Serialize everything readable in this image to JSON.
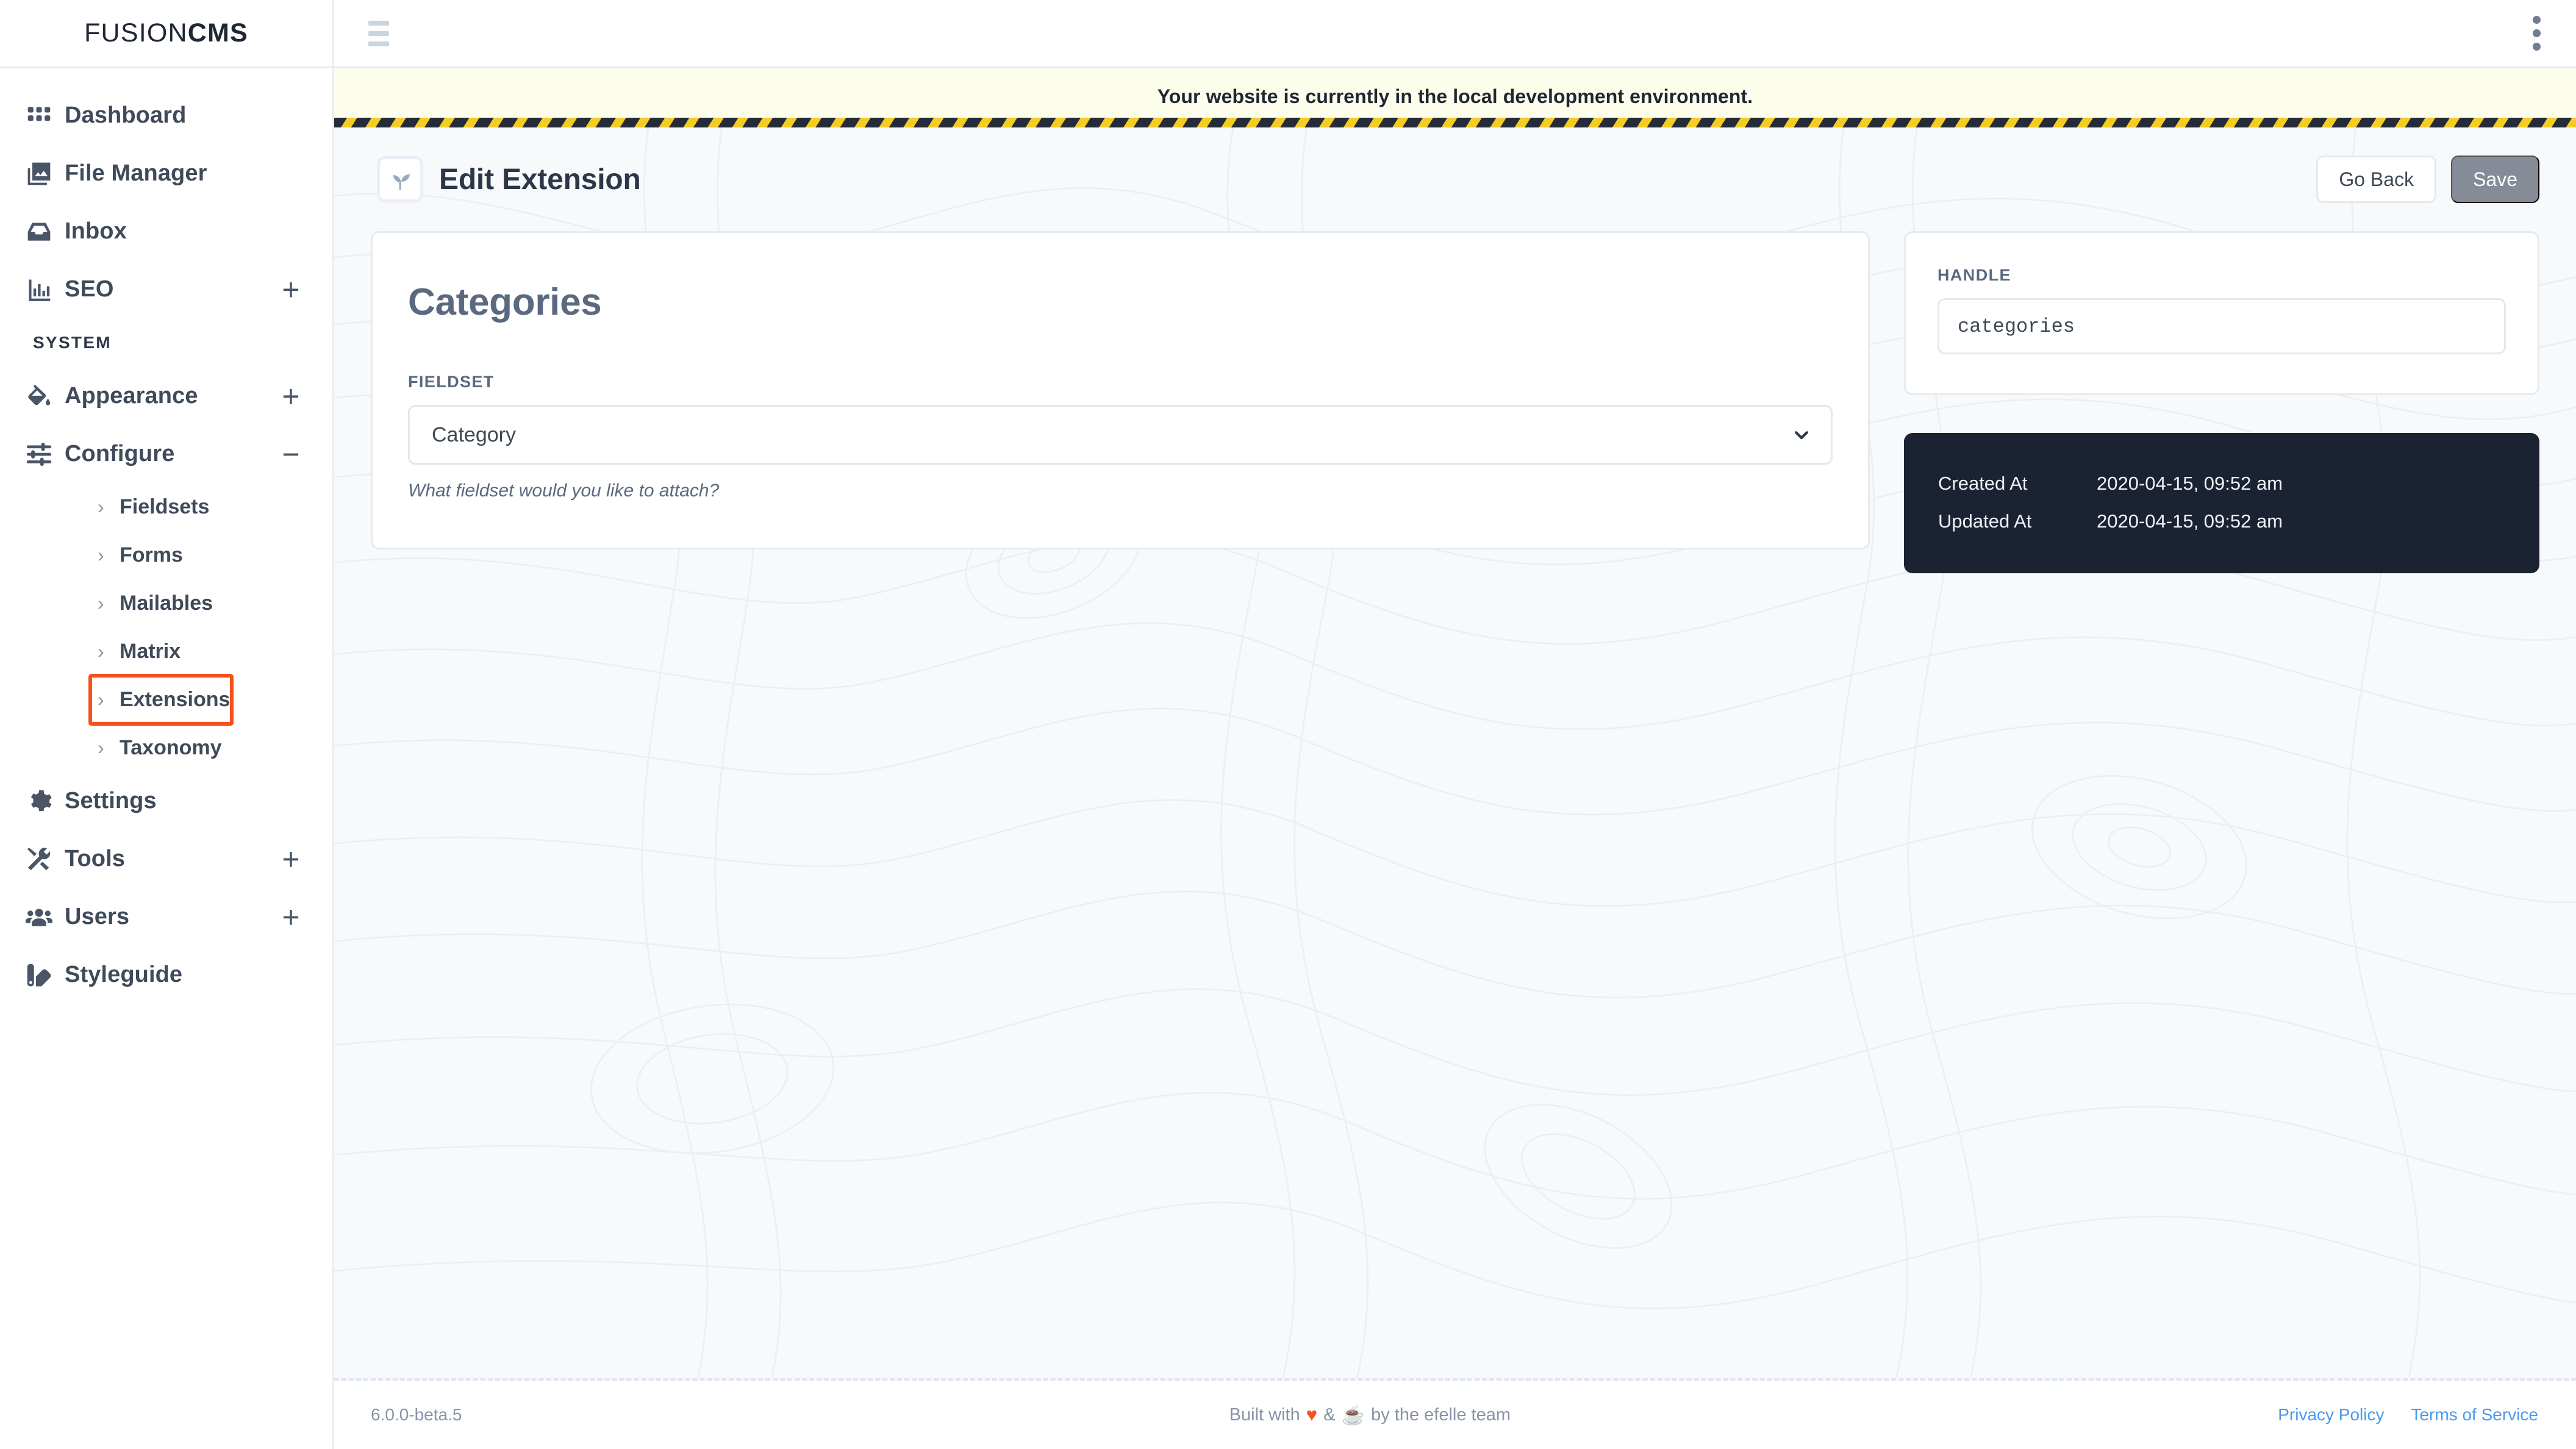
{
  "brand": {
    "light": "FUSION",
    "bold": "CMS"
  },
  "sidebar": {
    "primary_items": [
      {
        "label": "Dashboard",
        "icon": "grid-icon",
        "has_plus": false
      },
      {
        "label": "File Manager",
        "icon": "images-icon",
        "has_plus": false
      },
      {
        "label": "Inbox",
        "icon": "inbox-icon",
        "has_plus": false
      },
      {
        "label": "SEO",
        "icon": "bar-chart-icon",
        "has_plus": true,
        "plus": "+"
      }
    ],
    "section_label": "SYSTEM",
    "system_items": [
      {
        "label": "Appearance",
        "icon": "paint-bucket-icon",
        "has_toggle": true,
        "toggle": "+"
      },
      {
        "label": "Configure",
        "icon": "sliders-icon",
        "has_toggle": true,
        "toggle": "−"
      }
    ],
    "configure_children": [
      {
        "label": "Fieldsets",
        "chevron": "›",
        "highlighted": false
      },
      {
        "label": "Forms",
        "chevron": "›",
        "highlighted": false
      },
      {
        "label": "Mailables",
        "chevron": "›",
        "highlighted": false
      },
      {
        "label": "Matrix",
        "chevron": "›",
        "highlighted": false
      },
      {
        "label": "Extensions",
        "chevron": "›",
        "highlighted": true
      },
      {
        "label": "Taxonomy",
        "chevron": "›",
        "highlighted": false
      }
    ],
    "tail_items": [
      {
        "label": "Settings",
        "icon": "gear-icon",
        "has_plus": false
      },
      {
        "label": "Tools",
        "icon": "tools-icon",
        "has_plus": true,
        "plus": "+"
      },
      {
        "label": "Users",
        "icon": "users-icon",
        "has_plus": true,
        "plus": "+"
      },
      {
        "label": "Styleguide",
        "icon": "swatch-icon",
        "has_plus": false
      }
    ],
    "highlight_color": "#f4511e"
  },
  "topbar": {
    "menu_icon": "hamburger-icon",
    "options_icon": "kebab-menu-icon"
  },
  "env_banner": {
    "text": "Your website is currently in the local development environment."
  },
  "page": {
    "icon": "seedling-icon",
    "title": "Edit Extension",
    "go_back_label": "Go Back",
    "save_label": "Save"
  },
  "main_card": {
    "title": "Categories",
    "fieldset": {
      "label": "FIELDSET",
      "value": "Category",
      "help": "What fieldset would you like to attach?",
      "chevron_icon": "chevron-down-icon"
    }
  },
  "side_panel": {
    "handle": {
      "label": "HANDLE",
      "value": "categories"
    },
    "meta": [
      {
        "key": "Created At",
        "value": "2020-04-15, 09:52 am"
      },
      {
        "key": "Updated At",
        "value": "2020-04-15, 09:52 am"
      }
    ]
  },
  "footer": {
    "version": "6.0.0-beta.5",
    "built_prefix": "Built with",
    "heart": "♥",
    "amp": "&",
    "coffee": "☕",
    "built_suffix": "by the efelle team",
    "links": [
      {
        "label": "Privacy Policy"
      },
      {
        "label": "Terms of Service"
      }
    ]
  }
}
